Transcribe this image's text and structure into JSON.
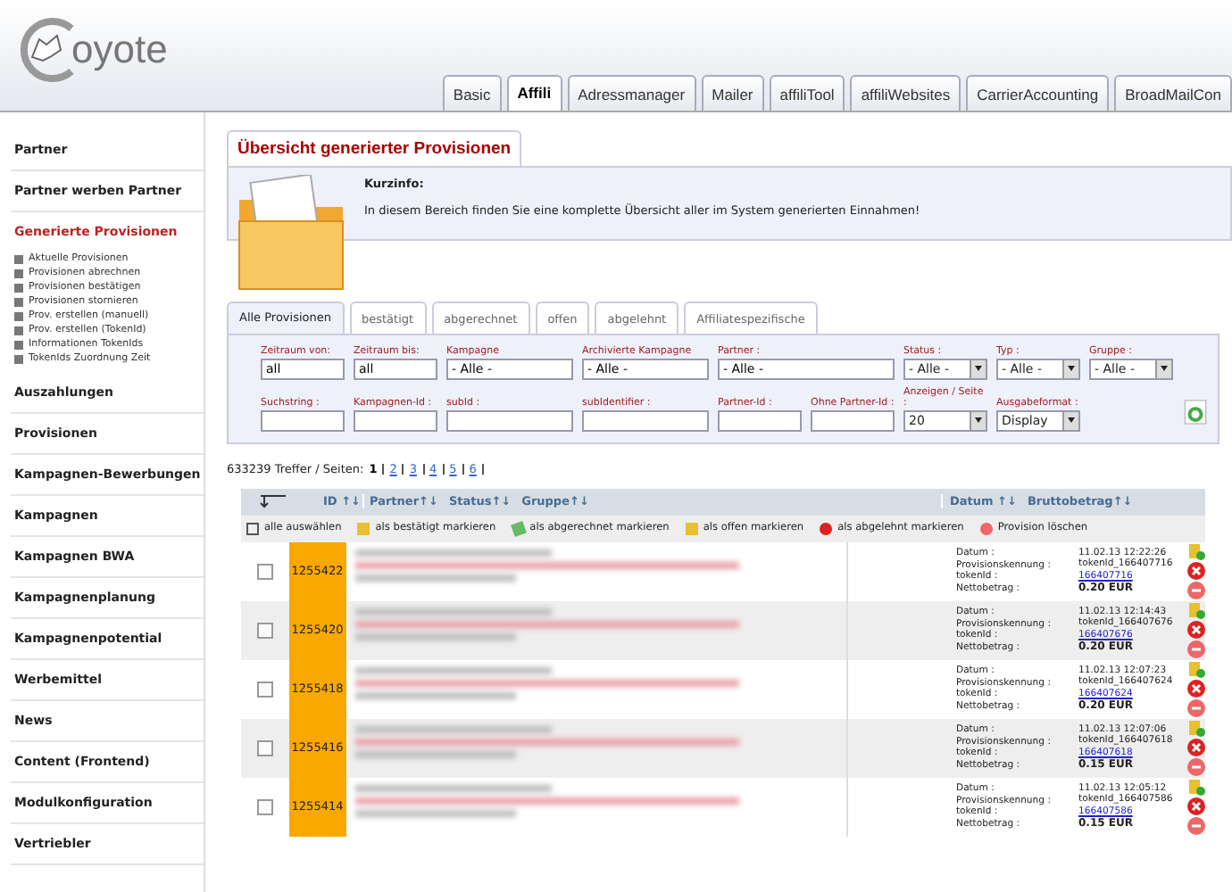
{
  "header": {
    "logo_text": "oyote",
    "tabs": [
      {
        "label": "Basic",
        "selected": false
      },
      {
        "label": "Affili",
        "selected": true
      },
      {
        "label": "Adressmanager",
        "selected": false
      },
      {
        "label": "Mailer",
        "selected": false
      },
      {
        "label": "affiliTool",
        "selected": false
      },
      {
        "label": "affiliWebsites",
        "selected": false
      },
      {
        "label": "CarrierAccounting",
        "selected": false
      },
      {
        "label": "BroadMailCon",
        "selected": false
      }
    ]
  },
  "sidebar": {
    "items": [
      {
        "label": "Partner",
        "selected": false
      },
      {
        "label": "Partner werben Partner",
        "selected": false
      },
      {
        "label": "Generierte Provisionen",
        "selected": true,
        "children": [
          "Aktuelle Provisionen",
          "Provisionen abrechnen",
          "Provisionen bestätigen",
          "Provisionen stornieren",
          "Prov. erstellen (manuell)",
          "Prov. erstellen (TokenId)",
          "Informationen TokenIds",
          "TokenIds Zuordnung Zeit"
        ]
      },
      {
        "label": "Auszahlungen",
        "selected": false
      },
      {
        "label": "Provisionen",
        "selected": false
      },
      {
        "label": "Kampagnen-Bewerbungen",
        "selected": false
      },
      {
        "label": "Kampagnen",
        "selected": false
      },
      {
        "label": "Kampagnen BWA",
        "selected": false
      },
      {
        "label": "Kampagnenplanung",
        "selected": false
      },
      {
        "label": "Kampagnenpotential",
        "selected": false
      },
      {
        "label": "Werbemittel",
        "selected": false
      },
      {
        "label": "News",
        "selected": false
      },
      {
        "label": "Content (Frontend)",
        "selected": false
      },
      {
        "label": "Modulkonfiguration",
        "selected": false
      },
      {
        "label": "Vertriebler",
        "selected": false
      }
    ]
  },
  "page_title": "Übersicht generierter Provisionen",
  "info": {
    "heading": "Kurzinfo:",
    "text": "In diesem Bereich finden Sie eine komplette Übersicht aller im System generierten Einnahmen!"
  },
  "filter_tabs": [
    {
      "label": "Alle Provisionen",
      "selected": true
    },
    {
      "label": "bestätigt",
      "selected": false
    },
    {
      "label": "abgerechnet",
      "selected": false
    },
    {
      "label": "offen",
      "selected": false
    },
    {
      "label": "abgelehnt",
      "selected": false
    },
    {
      "label": "Affiliatespezifische",
      "selected": false
    }
  ],
  "filters": [
    [
      {
        "label": "Zeitraum von:",
        "value": "all",
        "kind": "text"
      },
      {
        "label": "Zeitraum bis:",
        "value": "all",
        "kind": "text"
      },
      {
        "label": "Kampagne",
        "value": "- Alle -",
        "kind": "text"
      },
      {
        "label": "Archivierte Kampagne",
        "value": "- Alle -",
        "kind": "text"
      },
      {
        "label": "Partner :",
        "value": "- Alle -",
        "kind": "text"
      },
      {
        "label": "Status :",
        "value": "- Alle -",
        "kind": "select"
      },
      {
        "label": "Typ :",
        "value": "- Alle -",
        "kind": "select"
      },
      {
        "label": "Gruppe :",
        "value": "- Alle -",
        "kind": "select"
      }
    ],
    [
      {
        "label": "Suchstring :",
        "kind": "text"
      },
      {
        "label": "Kampagnen-Id :",
        "kind": "text"
      },
      {
        "label": "subId :",
        "kind": "text"
      },
      {
        "label": "subIdentifier :",
        "kind": "text"
      },
      {
        "label": "Partner-Id :",
        "kind": "text"
      },
      {
        "label": "Ohne Partner-Id :",
        "kind": "text"
      },
      {
        "label": "Anzeigen / Seite :",
        "value": "20",
        "kind": "select"
      },
      {
        "label": "Ausgabeformat :",
        "value": "Display",
        "kind": "select"
      }
    ]
  ],
  "results": {
    "count": "633239 Treffer / Seiten:",
    "pages": [
      {
        "label": "1",
        "selected": true
      },
      {
        "label": "2",
        "selected": false
      },
      {
        "label": "3",
        "selected": false
      },
      {
        "label": "4",
        "selected": false
      },
      {
        "label": "5",
        "selected": false
      },
      {
        "label": "6",
        "selected": false
      }
    ]
  },
  "table": {
    "columns": [
      "ID ↑↓",
      "Partner↑↓",
      "Status↑↓",
      "Gruppe↑↓",
      "Datum ↑↓",
      "Bruttobetrag↑↓"
    ],
    "actions": [
      {
        "label": "alle auswählen",
        "kind": "select"
      },
      {
        "label": "als bestätigt markieren",
        "kind": "confirm"
      },
      {
        "label": "als abgerechnet markieren",
        "kind": "settle"
      },
      {
        "label": "als offen markieren",
        "kind": "open"
      },
      {
        "label": "als abgelehnt markieren",
        "kind": "reject"
      },
      {
        "label": "Provision löschen",
        "kind": "delete"
      }
    ],
    "rows": [
      {
        "id": "1255422",
        "checked": false,
        "labels": [
          "Datum :",
          "Provisionskennung :",
          "tokenId :",
          "Nettobetrag :"
        ],
        "date": "11.02.13 12:22:26",
        "code": "tokenId_166407716",
        "token": "166407716",
        "net": "0.20 EUR"
      },
      {
        "id": "1255420",
        "checked": false,
        "labels": [
          "Datum :",
          "Provisionskennung :",
          "tokenId :",
          "Nettobetrag :"
        ],
        "date": "11.02.13 12:14:43",
        "code": "tokenId_166407676",
        "token": "166407676",
        "net": "0.20 EUR"
      },
      {
        "id": "1255418",
        "checked": false,
        "labels": [
          "Datum :",
          "Provisionskennung :",
          "tokenId :",
          "Nettobetrag :"
        ],
        "date": "11.02.13 12:07:23",
        "code": "tokenId_166407624",
        "token": "166407624",
        "net": "0.20 EUR"
      },
      {
        "id": "1255416",
        "checked": false,
        "labels": [
          "Datum :",
          "Provisionskennung :",
          "tokenId :",
          "Nettobetrag :"
        ],
        "date": "11.02.13 12:07:06",
        "code": "tokenId_166407618",
        "token": "166407618",
        "net": "0.15 EUR"
      },
      {
        "id": "1255414",
        "checked": false,
        "labels": [
          "Datum :",
          "Provisionskennung :",
          "tokenId :",
          "Nettobetrag :"
        ],
        "date": "11.02.13 12:05:12",
        "code": "tokenId_166407586",
        "token": "166407586",
        "net": "0.15 EUR"
      }
    ]
  }
}
